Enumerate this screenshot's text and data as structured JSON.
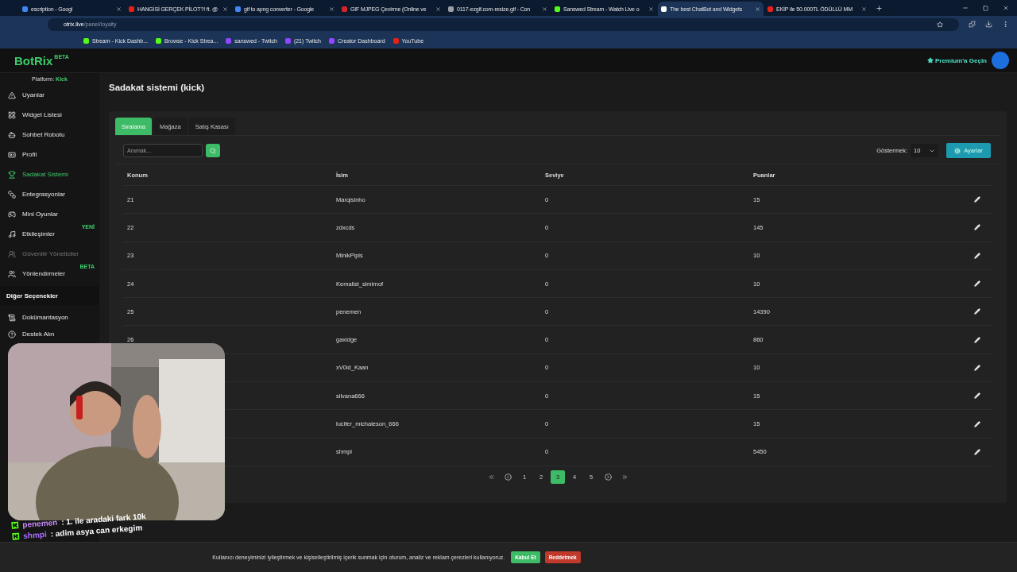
{
  "browser": {
    "tabs": [
      {
        "title": "escription - Googl",
        "selected": false,
        "color": "#4285f4"
      },
      {
        "title": "HANGİSİ GERÇEK PİLOT?! ft. @",
        "selected": false,
        "color": "#e62117"
      },
      {
        "title": "gif to apng converter - Google",
        "selected": false,
        "color": "#4285f4"
      },
      {
        "title": "GIF MJPEG Çevirme (Online ve",
        "selected": false,
        "color": "#d4242a"
      },
      {
        "title": "0117-ezgif.com-resize.gif - Con",
        "selected": false,
        "color": "#9aa0a6"
      },
      {
        "title": "Sanswed Stream - Watch Live o",
        "selected": false,
        "color": "#53fc18"
      },
      {
        "title": "The best ChatBot and Widgets",
        "selected": true,
        "color": "#ffffff"
      },
      {
        "title": "EKİP ile 50.000TL ÖDÜLLÜ MM",
        "selected": false,
        "color": "#e62117"
      }
    ],
    "address": {
      "domain": "otrix.live",
      "path": "/panel/loyalty"
    },
    "bookmarks": [
      {
        "title": "Stream - Kick Dashb...",
        "color": "#53fc18"
      },
      {
        "title": "Browse - Kick Strea...",
        "color": "#53fc18"
      },
      {
        "title": "sanswed - Twitch",
        "color": "#9146ff"
      },
      {
        "title": "(21) Twitch",
        "color": "#9146ff"
      },
      {
        "title": "Creator Dashboard",
        "color": "#9146ff"
      },
      {
        "title": "YouTube",
        "color": "#e62117"
      }
    ]
  },
  "header": {
    "logo": "BotRix",
    "logo_badge": "BETA",
    "premium": "Premium'a Geçin"
  },
  "sidebar": {
    "platform_label": "Platform:",
    "platform": "Kick",
    "items": [
      {
        "label": "Uyarılar",
        "selected": false,
        "disabled": false
      },
      {
        "label": "Widget Listesi",
        "selected": false,
        "disabled": false
      },
      {
        "label": "Sohbet Robotu",
        "selected": false,
        "disabled": false
      },
      {
        "label": "Profil",
        "selected": false,
        "disabled": false
      },
      {
        "label": "Sadakat Sistemi",
        "selected": true,
        "disabled": false
      },
      {
        "label": "Entegrasyonlar",
        "selected": false,
        "disabled": false
      },
      {
        "label": "Mini Oyunlar",
        "selected": false,
        "disabled": false
      },
      {
        "label": "Etkileşimler",
        "selected": false,
        "disabled": false,
        "badge": "YENİ"
      },
      {
        "label": "Güvenilir Yöneticiler",
        "selected": false,
        "disabled": true
      },
      {
        "label": "Yönlendirmeler",
        "selected": false,
        "disabled": false,
        "badge": "BETA"
      }
    ],
    "section": "Diğer Seçenekler",
    "extra_items": [
      {
        "label": "Dokümantasyon"
      },
      {
        "label": "Destek Alın"
      }
    ]
  },
  "page": {
    "title": "Sadakat sistemi (kick)",
    "tabs": [
      {
        "label": "Sıralama",
        "selected": true
      },
      {
        "label": "Mağaza",
        "selected": false
      },
      {
        "label": "Satış Kasası",
        "selected": false
      }
    ],
    "search": {
      "placeholder": "Aramak..."
    },
    "show_label": "Göstermek:",
    "show_value": "10",
    "settings_button": "Ayarlar",
    "table": {
      "columns": [
        "Konum",
        "İsim",
        "Seviye",
        "Puanlar"
      ],
      "rows": [
        {
          "konum": "21",
          "isim": "Marqisinho",
          "seviye": "0",
          "puanlar": "15"
        },
        {
          "konum": "22",
          "isim": "zdxcds",
          "seviye": "0",
          "puanlar": "145"
        },
        {
          "konum": "23",
          "isim": "MinikPipis",
          "seviye": "0",
          "puanlar": "10"
        },
        {
          "konum": "24",
          "isim": "Kemalist_simirnof",
          "seviye": "0",
          "puanlar": "10"
        },
        {
          "konum": "25",
          "isim": "penemen",
          "seviye": "0",
          "puanlar": "14390"
        },
        {
          "konum": "26",
          "isim": "gaxidge",
          "seviye": "0",
          "puanlar": "860"
        },
        {
          "isim": "xV0id_Kaan",
          "seviye": "0",
          "puanlar": "10"
        },
        {
          "isim": "silvana666",
          "seviye": "0",
          "puanlar": "15"
        },
        {
          "isim": "lucifer_michaleson_666",
          "seviye": "0",
          "puanlar": "15"
        },
        {
          "isim": "shmpi",
          "seviye": "0",
          "puanlar": "5450"
        }
      ]
    },
    "pagination": [
      {
        "label": "1",
        "selected": false
      },
      {
        "label": "2",
        "selected": false
      },
      {
        "label": "3",
        "selected": true
      },
      {
        "label": "4",
        "selected": false
      },
      {
        "label": "5",
        "selected": false
      }
    ]
  },
  "chat": [
    {
      "user": "penemen",
      "color": "#c58af9",
      "message": ": 1. ile aradaki fark 10k"
    },
    {
      "user": "shmpi",
      "color": "#a970ff",
      "message": ": adim asya can erkegim"
    }
  ],
  "cookie": {
    "text": "Kullanıcı deneyiminizi iyileştirmek ve kişiselleştirilmiş içerik sunmak için oturum, analiz ve reklam çerezleri kullanıyoruz.",
    "accept": "Kabul Et",
    "reject": "Reddetmek"
  }
}
